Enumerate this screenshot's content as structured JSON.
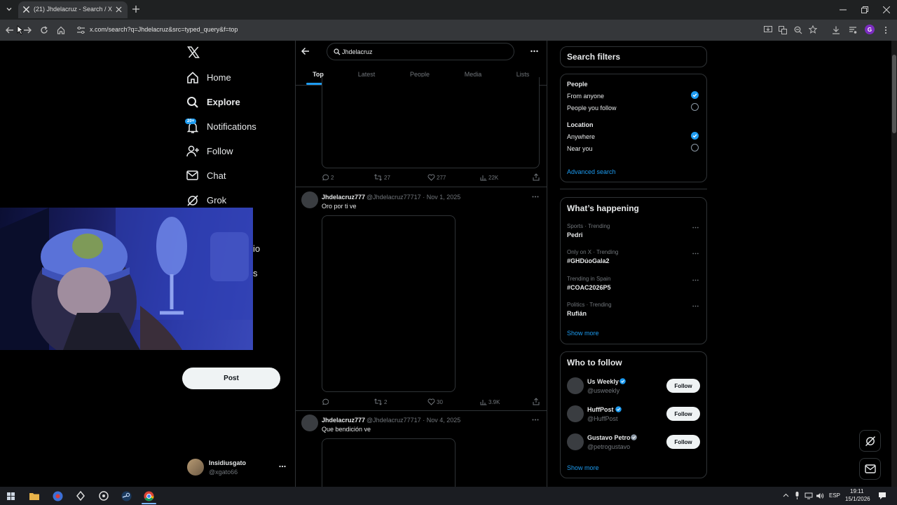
{
  "browser": {
    "tab_title": "(21) Jhdelacruz - Search / X",
    "url": "x.com/search?q=Jhdelacruz&src=typed_query&f=top",
    "profile_initial": "G"
  },
  "sidebar": {
    "items": [
      {
        "label": "Home"
      },
      {
        "label": "Explore"
      },
      {
        "label": "Notifications",
        "badge": "20+"
      },
      {
        "label": "Follow"
      },
      {
        "label": "Chat"
      },
      {
        "label": "Grok"
      }
    ],
    "partial_labels": [
      "io",
      "s"
    ],
    "post_label": "Post",
    "account": {
      "name": "Insidiusgato",
      "handle": "@xgato66"
    }
  },
  "search": {
    "query": "Jhdelacruz",
    "tabs": [
      "Top",
      "Latest",
      "People",
      "Media",
      "Lists"
    ],
    "active_tab": "Top"
  },
  "posts": [
    {
      "replies": "2",
      "reposts": "27",
      "likes": "277",
      "views": "22K"
    },
    {
      "name": "Jhdelacruz777",
      "handle": "@Jhdelacruz77717",
      "date": "Nov 1, 2025",
      "text": "Oro por ti ve",
      "replies": "",
      "reposts": "2",
      "likes": "30",
      "views": "3.9K"
    },
    {
      "name": "Jhdelacruz777",
      "handle": "@Jhdelacruz77717",
      "date": "Nov 4, 2025",
      "text": "Que bendición ve"
    }
  ],
  "filters": {
    "title": "Search filters",
    "people_heading": "People",
    "people_options": [
      "From anyone",
      "People you follow"
    ],
    "location_heading": "Location",
    "location_options": [
      "Anywhere",
      "Near you"
    ],
    "advanced": "Advanced search"
  },
  "trending": {
    "title": "What’s happening",
    "items": [
      {
        "context": "Sports · Trending",
        "topic": "Pedri"
      },
      {
        "context": "Only on X · Trending",
        "topic": "#GHDúoGala2"
      },
      {
        "context": "Trending in Spain",
        "topic": "#COAC2026P5"
      },
      {
        "context": "Politics · Trending",
        "topic": "Rufián"
      }
    ],
    "show_more": "Show more"
  },
  "who_to_follow": {
    "title": "Who to follow",
    "accounts": [
      {
        "name": "Us Weekly",
        "handle": "@usweekly"
      },
      {
        "name": "HuffPost",
        "handle": "@HuffPost"
      },
      {
        "name": "Gustavo Petro",
        "handle": "@petrogustavo"
      }
    ],
    "follow_label": "Follow",
    "show_more": "Show more"
  },
  "taskbar": {
    "lang": "ESP",
    "time": "19:11",
    "date": "15/1/2026"
  },
  "colors": {
    "accent": "#1d9bf0",
    "background": "#000000",
    "border": "#2f3336",
    "muted": "#71767b"
  }
}
